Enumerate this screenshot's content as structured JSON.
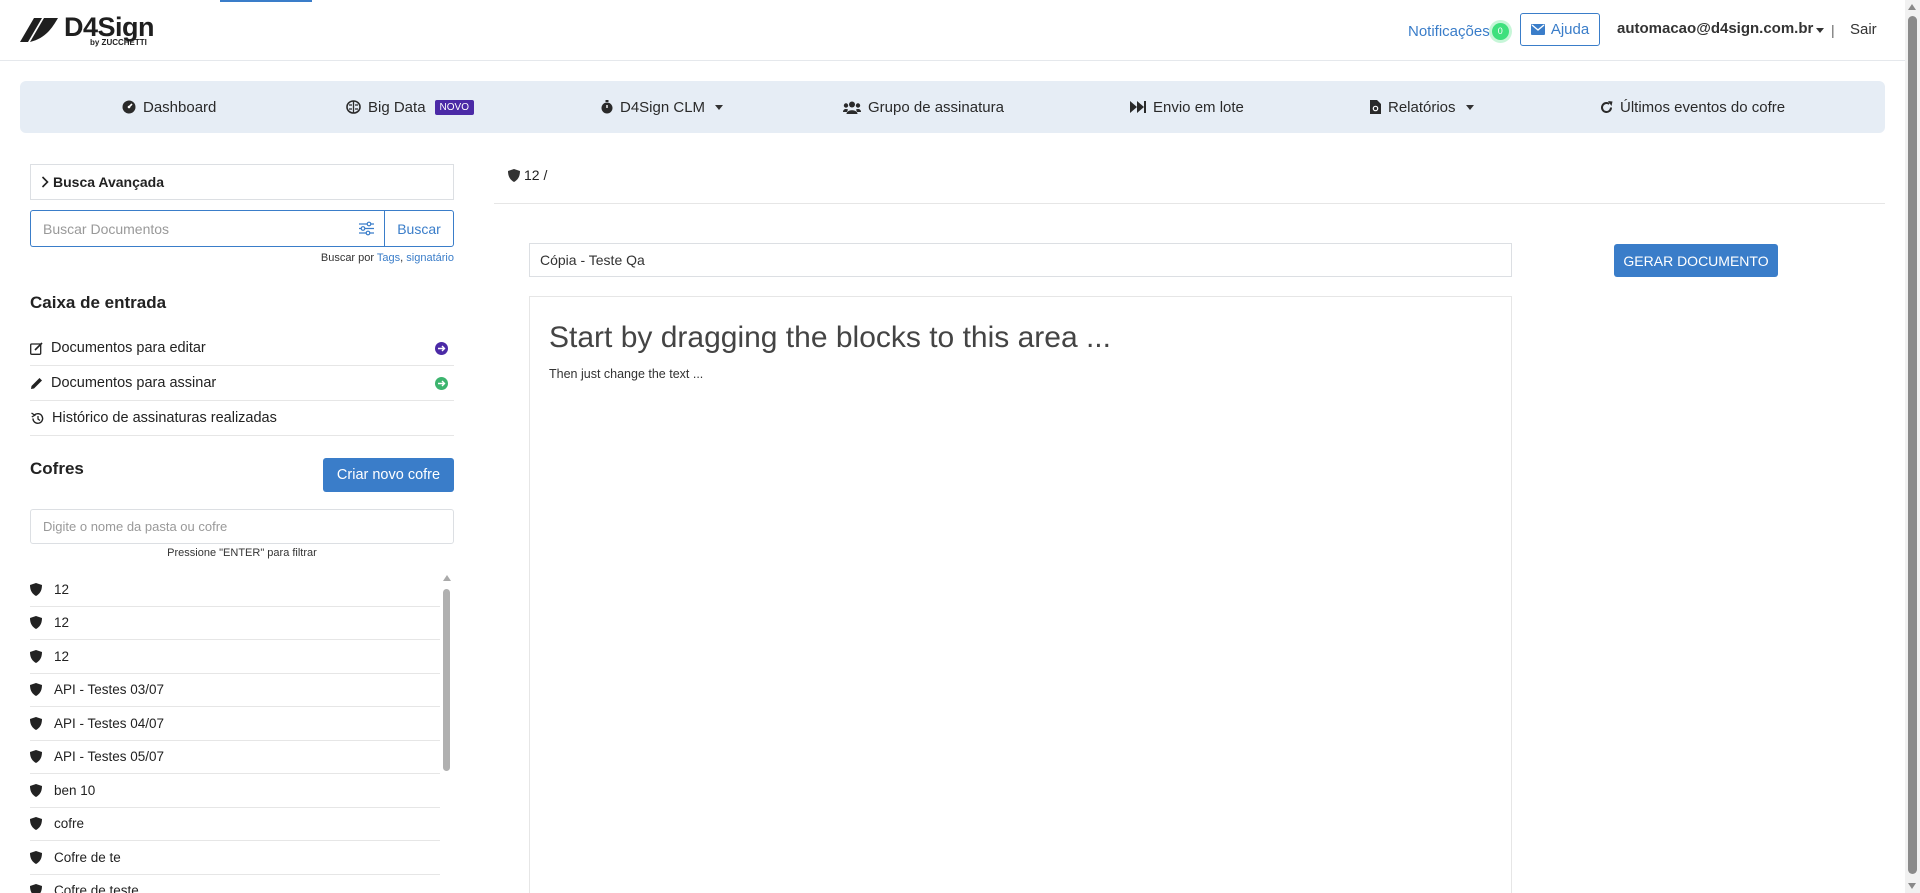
{
  "header": {
    "logo_name": "D4Sign",
    "logo_sub": "by ZUCCHETTI",
    "notifications_label": "Notificações",
    "notifications_count": "0",
    "help_label": "Ajuda",
    "user_email": "automacao@d4sign.com.br",
    "separator": "|",
    "logout_label": "Sair"
  },
  "nav": {
    "dashboard": "Dashboard",
    "bigdata": "Big Data",
    "bigdata_badge": "NOVO",
    "clm": "D4Sign CLM",
    "group": "Grupo de assinatura",
    "batch": "Envio em lote",
    "reports": "Relatórios",
    "events": "Últimos eventos do cofre"
  },
  "sidebar": {
    "advanced_search": "Busca Avançada",
    "search_placeholder": "Buscar Documentos",
    "search_button": "Buscar",
    "search_hint_prefix": "Buscar por",
    "search_hint_tags": "Tags",
    "search_hint_comma": ",",
    "search_hint_signer": "signatário",
    "inbox_title": "Caixa de entrada",
    "inbox_items": [
      {
        "label": "Documentos para editar"
      },
      {
        "label": "Documentos para assinar"
      },
      {
        "label": "Histórico de assinaturas realizadas"
      }
    ],
    "vaults_title": "Cofres",
    "new_vault_button": "Criar novo cofre",
    "vault_filter_placeholder": "Digite o nome da pasta ou cofre",
    "vault_filter_hint": "Pressione \"ENTER\" para filtrar",
    "vaults": [
      {
        "name": "12"
      },
      {
        "name": "12"
      },
      {
        "name": "12"
      },
      {
        "name": "API - Testes 03/07"
      },
      {
        "name": "API - Testes 04/07"
      },
      {
        "name": "API - Testes 05/07"
      },
      {
        "name": "ben 10"
      },
      {
        "name": "cofre"
      },
      {
        "name": "Cofre de te"
      },
      {
        "name": "Cofre de teste"
      }
    ]
  },
  "main": {
    "breadcrumb": "12 /",
    "document_name": "Cópia - Teste Qa",
    "generate_button": "GERAR DOCUMENTO",
    "editor_heading": "Start by dragging the blocks to this area ...",
    "editor_subtext": "Then just change the text ..."
  },
  "colors": {
    "primary": "#3a7dc9",
    "nav_bg": "#e6edf5",
    "badge_purple": "#4b2aa6",
    "notif_green": "#3ee07d",
    "edit_arrow": "#4b2aa6",
    "sign_arrow": "#3cb46e"
  }
}
